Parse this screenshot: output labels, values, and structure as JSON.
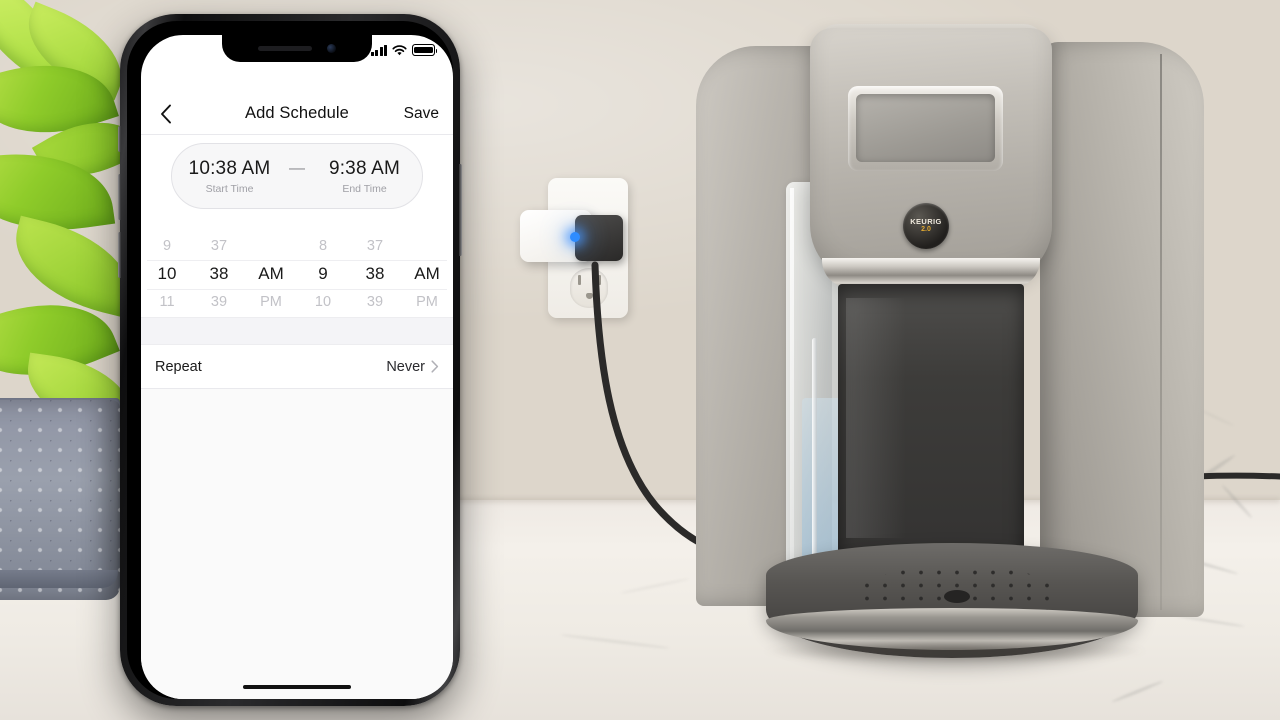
{
  "scene": {
    "description": "Keurig 2.0 coffee maker on marble countertop plugged into a white smart plug; iPhone in foreground showing a schedule app",
    "plant_label": "potted-plant",
    "keurig": {
      "brand": "KEURIG",
      "version": "2.0"
    },
    "smart_plug": {
      "led_color": "#2e8cff",
      "led_state": "on"
    }
  },
  "phone": {
    "status_bar": {
      "signal_icon": "cellular-signal-icon",
      "wifi_icon": "wifi-icon",
      "battery_icon": "battery-icon"
    },
    "nav": {
      "back_icon": "chevron-left-icon",
      "title": "Add Schedule",
      "save_label": "Save"
    },
    "time_pill": {
      "start_time": "10:38 AM",
      "start_label": "Start Time",
      "separator": "—",
      "end_time": "9:38 AM",
      "end_label": "End Time"
    },
    "picker": {
      "start": {
        "hours": [
          "9",
          "10",
          "11"
        ],
        "minutes": [
          "37",
          "38",
          "39"
        ],
        "meridiem": [
          "",
          "AM",
          "PM"
        ],
        "selected_hour": "10",
        "selected_minute": "38",
        "selected_meridiem": "AM"
      },
      "end": {
        "hours": [
          "8",
          "9",
          "10"
        ],
        "minutes": [
          "37",
          "38",
          "39"
        ],
        "meridiem": [
          "",
          "AM",
          "PM"
        ],
        "selected_hour": "9",
        "selected_minute": "38",
        "selected_meridiem": "AM"
      }
    },
    "repeat_row": {
      "label": "Repeat",
      "value": "Never",
      "chevron_icon": "chevron-right-icon"
    },
    "home_indicator": "home-indicator"
  },
  "colors": {
    "accent_blue": "#2e8cff",
    "text_primary": "#1a1a1a",
    "text_muted": "#c2c2c7",
    "pill_bg": "#f7f7f8",
    "keurig_gold": "#e0a830"
  }
}
